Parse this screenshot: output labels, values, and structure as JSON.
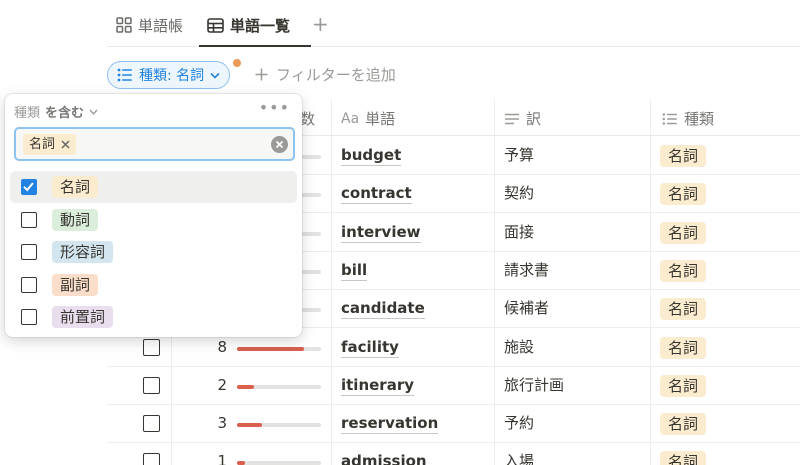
{
  "tabs": [
    {
      "label": "単語帳",
      "icon": "gallery-icon",
      "active": false
    },
    {
      "label": "単語一覧",
      "icon": "table-icon",
      "active": true
    }
  ],
  "filter": {
    "chip_label": "種類: 名詞",
    "add_filter_label": "フィルターを追加"
  },
  "table": {
    "headers": {
      "count": "数",
      "word": "単語",
      "word_prefix": "Aa",
      "translation": "訳",
      "type": "種類"
    },
    "rows": [
      {
        "count": "",
        "progress": 0.12,
        "word": "budget",
        "translation": "予算",
        "type": "名詞"
      },
      {
        "count": "",
        "progress": 0.12,
        "word": "contract",
        "translation": "契約",
        "type": "名詞"
      },
      {
        "count": "",
        "progress": 0.12,
        "word": "interview",
        "translation": "面接",
        "type": "名詞"
      },
      {
        "count": "",
        "progress": 0.12,
        "word": "bill",
        "translation": "請求書",
        "type": "名詞"
      },
      {
        "count": "",
        "progress": 0.12,
        "word": "candidate",
        "translation": "候補者",
        "type": "名詞"
      },
      {
        "count": "8",
        "progress": 0.8,
        "word": "facility",
        "translation": "施設",
        "type": "名詞"
      },
      {
        "count": "2",
        "progress": 0.2,
        "word": "itinerary",
        "translation": "旅行計画",
        "type": "名詞"
      },
      {
        "count": "3",
        "progress": 0.3,
        "word": "reservation",
        "translation": "予約",
        "type": "名詞"
      },
      {
        "count": "1",
        "progress": 0.1,
        "word": "admission",
        "translation": "入場",
        "type": "名詞"
      }
    ]
  },
  "dropdown": {
    "header_property": "種類",
    "header_operator": "を含む",
    "selected_tag": "名詞",
    "options": [
      {
        "label": "名詞",
        "checked": true,
        "color": "#fbecd0"
      },
      {
        "label": "動詞",
        "checked": false,
        "color": "#dbeddb"
      },
      {
        "label": "形容詞",
        "checked": false,
        "color": "#d3e5ef"
      },
      {
        "label": "副詞",
        "checked": false,
        "color": "#fadec9"
      },
      {
        "label": "前置詞",
        "checked": false,
        "color": "#e8deee"
      }
    ]
  },
  "colors": {
    "accent": "#2383e2",
    "noun_tag": "#fbecd0",
    "progress_bar": "#d9604f"
  }
}
